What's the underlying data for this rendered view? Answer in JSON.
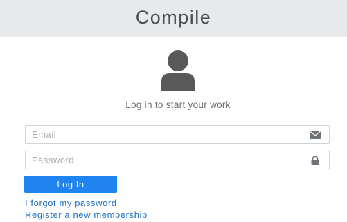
{
  "header": {
    "title": "Compile"
  },
  "login_box": {
    "avatar_icon": "user-avatar-icon",
    "message": "Log in to start your work",
    "email": {
      "placeholder": "Email",
      "value": "",
      "icon": "envelope-icon"
    },
    "password": {
      "placeholder": "Password",
      "value": "",
      "icon": "lock-icon"
    },
    "login_button_label": "Log In",
    "forgot_password_link": "I forgot my password",
    "register_link": "Register a new membership"
  },
  "colors": {
    "header_background": "#e7e9ea",
    "primary_button": "#1f83f0",
    "link": "#1f6fbf",
    "avatar": "#595959"
  }
}
